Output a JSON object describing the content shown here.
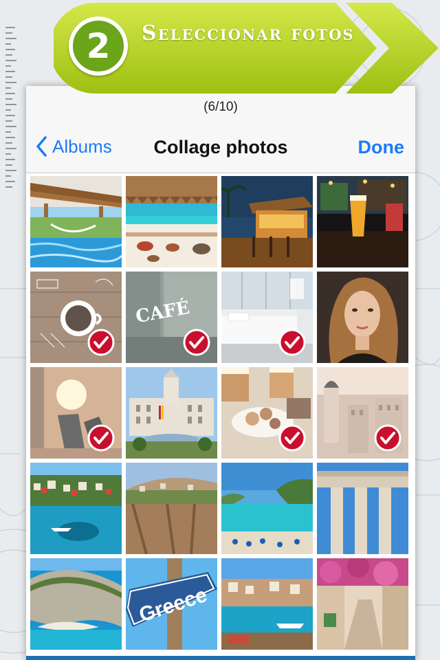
{
  "banner": {
    "step_number": "2",
    "title": "Seleccionar fotos",
    "color": "#b6d31e"
  },
  "picker": {
    "count": "(6/10)",
    "back_label": "Albums",
    "title": "Collage photos",
    "done_label": "Done",
    "accent": "#1a7cf5"
  },
  "photos": [
    {
      "name": "pool-hammocks",
      "selected": false
    },
    {
      "name": "beach-thatch",
      "selected": false
    },
    {
      "name": "tiki-bar-night",
      "selected": false
    },
    {
      "name": "pub-beer",
      "selected": false
    },
    {
      "name": "coffee-cup-table",
      "selected": true
    },
    {
      "name": "cafe-window",
      "selected": true
    },
    {
      "name": "hotel-bedroom",
      "selected": true
    },
    {
      "name": "woman-portrait",
      "selected": false
    },
    {
      "name": "sunset-shoes",
      "selected": true
    },
    {
      "name": "madrid-palace",
      "selected": false
    },
    {
      "name": "tapas-beer",
      "selected": true
    },
    {
      "name": "madrid-skyline",
      "selected": true
    },
    {
      "name": "parga-harbor",
      "selected": false
    },
    {
      "name": "monemvasia-cliff",
      "selected": false
    },
    {
      "name": "turquoise-bay",
      "selected": false
    },
    {
      "name": "caryatids",
      "selected": false
    },
    {
      "name": "navagio-beach",
      "selected": false
    },
    {
      "name": "greece-sign",
      "selected": false
    },
    {
      "name": "harbor-town",
      "selected": false
    },
    {
      "name": "flower-street",
      "selected": false
    }
  ],
  "sign_text": "Greece",
  "cafe_text": "CAFÉ"
}
